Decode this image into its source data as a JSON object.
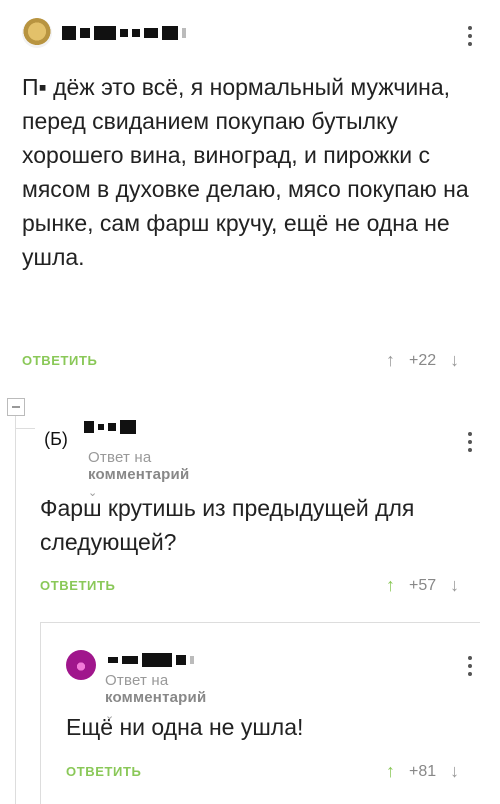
{
  "comments": [
    {
      "text": "П▪ дёж это всё, я нормальный мужчина, перед свиданием покупаю бутылку хорошего вина, виноград, и пирожки с мясом в духовке делаю, мясо покупаю на рынке, сам фарш кручу, ещё не одна не ушла.",
      "reply_label": "ОТВЕТИТЬ",
      "votes": "+22"
    },
    {
      "avatar_text": "(Б)",
      "reply_to_prefix": "Ответ на",
      "reply_to_target": "комментарий",
      "text": "Фарш крутишь из предыдущей для следующей?",
      "reply_label": "ОТВЕТИТЬ",
      "votes": "+57"
    },
    {
      "reply_to_prefix": "Ответ на",
      "reply_to_target": "комментарий",
      "text": "Ещё ни одна не ушла!",
      "reply_label": "ОТВЕТИТЬ",
      "votes": "+81"
    }
  ],
  "icons": {
    "vote_up": "arrow-up-icon",
    "vote_down": "arrow-down-icon",
    "more": "kebab-menu-icon",
    "reply_to_chevron": "chevron-down-icon",
    "collapse": "collapse-thread-icon"
  },
  "colors": {
    "accent_green": "#8ac858",
    "muted_gray": "#999999",
    "text": "#222222",
    "avatar_purple": "#a0168c"
  }
}
